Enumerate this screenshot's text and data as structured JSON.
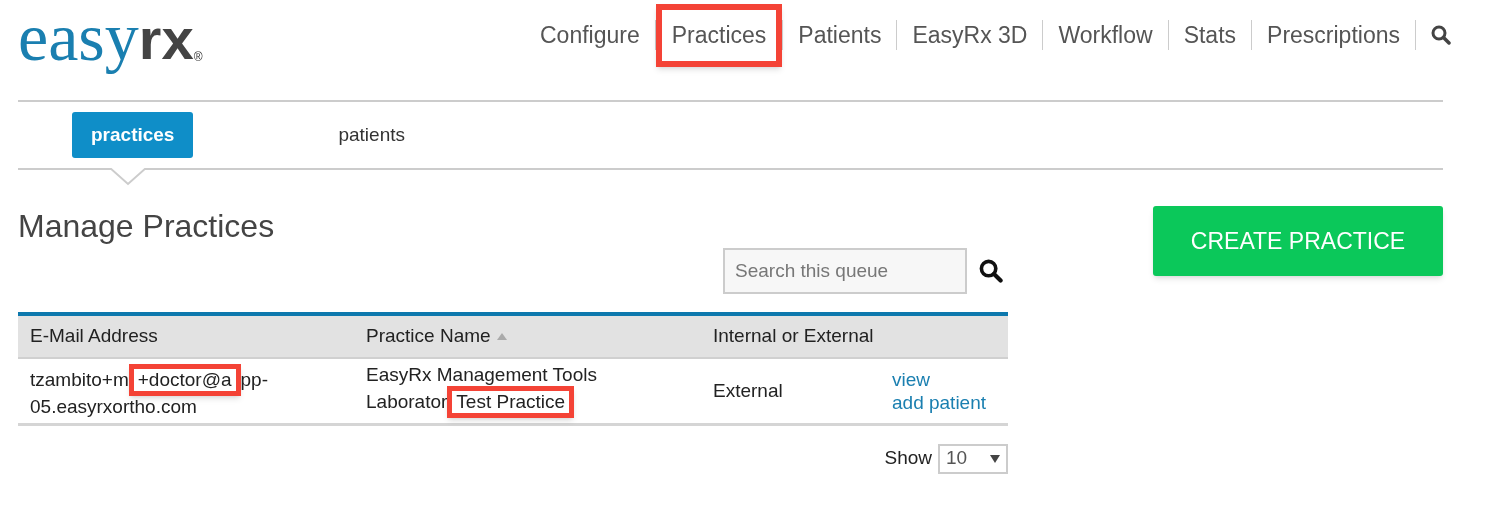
{
  "logo": {
    "part_1": "easy",
    "part_2": "rx",
    "mark": "®"
  },
  "nav": [
    {
      "label": "Configure",
      "highlighted": false
    },
    {
      "label": "Practices",
      "highlighted": true
    },
    {
      "label": "Patients",
      "highlighted": false
    },
    {
      "label": "EasyRx 3D",
      "highlighted": false
    },
    {
      "label": "Workflow",
      "highlighted": false
    },
    {
      "label": "Stats",
      "highlighted": false
    },
    {
      "label": "Prescriptions",
      "highlighted": false
    }
  ],
  "subtabs": [
    {
      "label": "practices",
      "selected": true
    },
    {
      "label": "patients",
      "selected": false
    }
  ],
  "title": "Manage Practices",
  "create_button": "CREATE PRACTICE",
  "search": {
    "placeholder": "Search this queue"
  },
  "table": {
    "columns": [
      {
        "label": "E-Mail Address",
        "sorted": false
      },
      {
        "label": "Practice Name",
        "sorted": true
      },
      {
        "label": "Internal or External",
        "sorted": false
      }
    ],
    "rows": [
      {
        "email": {
          "before": "tzambito+m",
          "highlight": "+doctor@a",
          "after": "pp-",
          "line_2": "05.easyrxortho.com"
        },
        "practice_name": {
          "before": "EasyRx Management Tools",
          "line_2": "Laborator",
          "highlight": "Test Practice"
        },
        "type": "External",
        "actions": [
          "view",
          "add patient"
        ]
      }
    ]
  },
  "show": {
    "label": "Show",
    "value": "10"
  }
}
